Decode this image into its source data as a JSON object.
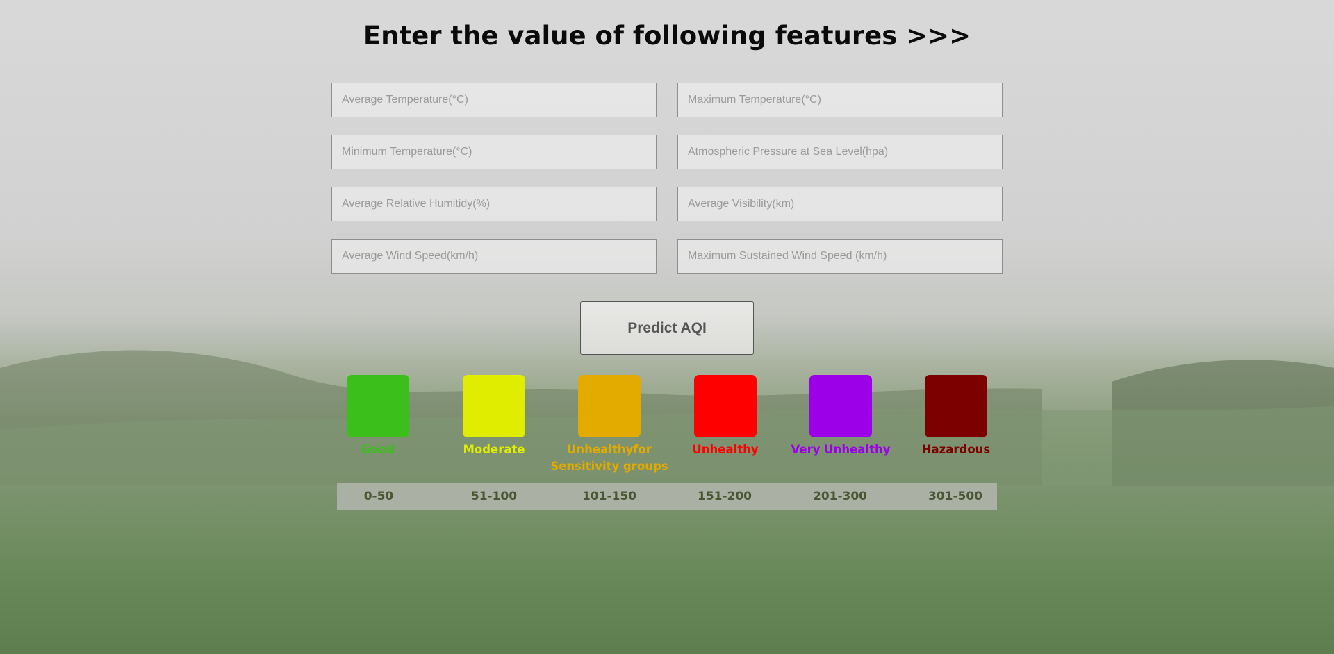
{
  "page": {
    "title": "Enter the value of following features >>>"
  },
  "form": {
    "fields": [
      {
        "placeholder": "Average Temperature(°C)"
      },
      {
        "placeholder": "Maximum Temperature(°C)"
      },
      {
        "placeholder": "Minimum Temperature(°C)"
      },
      {
        "placeholder": "Atmospheric Pressure at Sea Level(hpa)"
      },
      {
        "placeholder": "Average Relative Humitidy(%)"
      },
      {
        "placeholder": "Average Visibility(km)"
      },
      {
        "placeholder": "Average Wind Speed(km/h)"
      },
      {
        "placeholder": "Maximum Sustained Wind Speed (km/h)"
      }
    ],
    "predict_label": "Predict AQI"
  },
  "legend": {
    "items": [
      {
        "label": "Good",
        "color": "#3bbf1a",
        "range": "0-50"
      },
      {
        "label": "Moderate",
        "color": "#e0ec00",
        "range": "51-100"
      },
      {
        "label": "Unhealthyfor Sensitivity groups",
        "color": "#e3ab00",
        "range": "101-150"
      },
      {
        "label": "Unhealthy",
        "color": "#ff0000",
        "range": "151-200"
      },
      {
        "label": "Very Unhealthy",
        "color": "#9b00e8",
        "range": "201-300"
      },
      {
        "label": "Hazardous",
        "color": "#7d0000",
        "range": "301-500"
      }
    ]
  }
}
